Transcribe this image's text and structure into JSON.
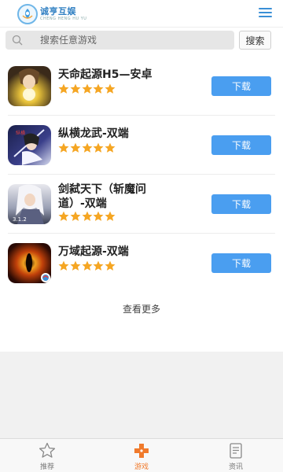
{
  "header": {
    "logo_cn": "诚亨互娱",
    "logo_en": "CHENG HENG HU YU"
  },
  "search": {
    "placeholder": "搜索任意游戏",
    "button_label": "搜索"
  },
  "games": [
    {
      "title": "天命起源H5—安卓",
      "rating": 5,
      "download_label": "下载",
      "icon": "game-icon-tianming"
    },
    {
      "title": "纵横龙武-双端",
      "rating": 5,
      "download_label": "下载",
      "icon": "game-icon-zongheng"
    },
    {
      "title": "剑弑天下（斩魔问道）-双端",
      "rating": 5,
      "download_label": "下载",
      "icon": "game-icon-jianshi"
    },
    {
      "title": "万域起源-双端",
      "rating": 5,
      "download_label": "下载",
      "icon": "game-icon-wanyu"
    }
  ],
  "see_more_label": "查看更多",
  "nav": [
    {
      "label": "推荐",
      "icon": "star-outline-icon",
      "active": false
    },
    {
      "label": "游戏",
      "icon": "gamepad-icon",
      "active": true
    },
    {
      "label": "资讯",
      "icon": "news-icon",
      "active": false
    }
  ],
  "colors": {
    "accent": "#4a9ef0",
    "active_nav": "#f07a2c",
    "star": "#f5a623"
  }
}
